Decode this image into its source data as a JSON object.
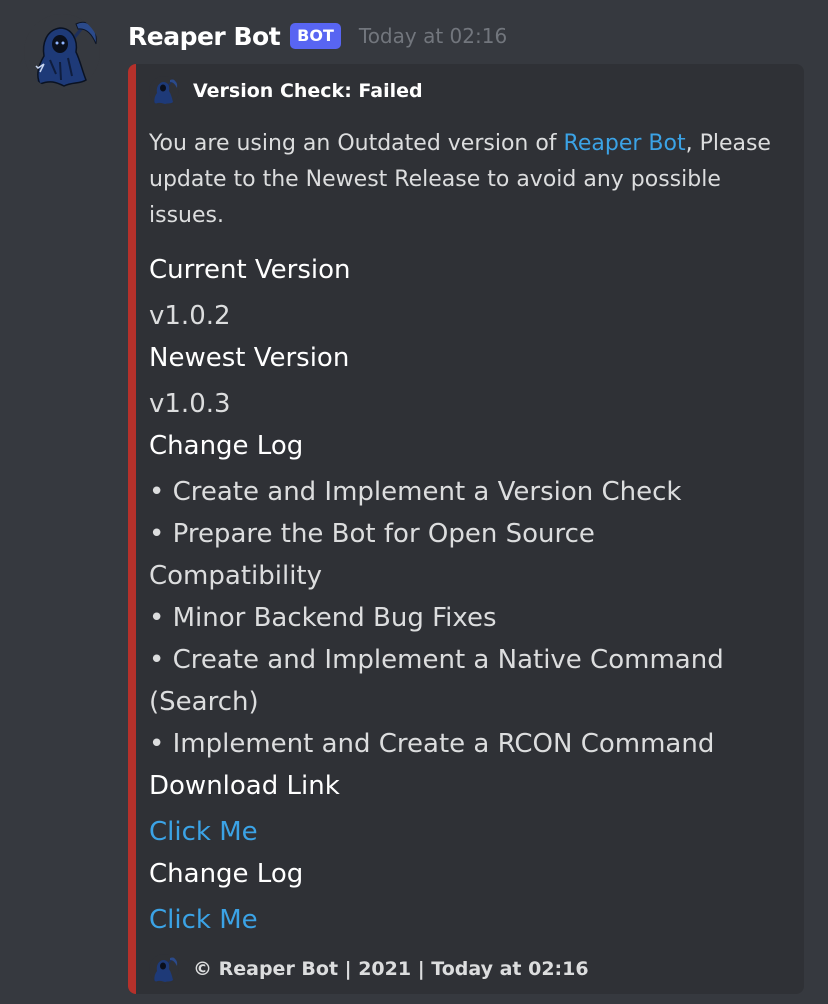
{
  "message": {
    "username": "Reaper Bot",
    "bot_tag": "BOT",
    "timestamp": "Today at 02:16",
    "avatar_icon": "grim-reaper-icon"
  },
  "embed": {
    "accent_color": "#b5312b",
    "author": {
      "name": "Version Check: Failed",
      "icon": "grim-reaper-icon"
    },
    "description": {
      "prefix": "You are using an Outdated version of ",
      "link_text": "Reaper Bot",
      "suffix": ", Please update to the Newest Release to avoid any possible issues."
    },
    "fields": {
      "current_version_name": "Current Version",
      "current_version_value": "v1.0.2",
      "newest_version_name": "Newest Version",
      "newest_version_value": "v1.0.3",
      "changelog_name": "Change Log",
      "changelog_items": [
        "• Create and Implement a Version Check",
        " • Prepare the Bot for Open Source",
        "Compatibility",
        " • Minor Backend Bug Fixes",
        " • Create and Implement a Native Command",
        "(Search)",
        " • Implement and Create a RCON Command"
      ],
      "download_link_name": "Download Link",
      "download_link_value": "Click Me",
      "changelog_link_name": "Change Log",
      "changelog_link_value": "Click Me"
    },
    "footer": {
      "text": "© Reaper Bot | 2021 | Today at 02:16",
      "icon": "grim-reaper-icon"
    }
  },
  "colors": {
    "background": "#36393f",
    "embed_background": "#2f3136",
    "link": "#3ba3e6",
    "bot_tag": "#5865f2",
    "timestamp": "#72767d"
  }
}
